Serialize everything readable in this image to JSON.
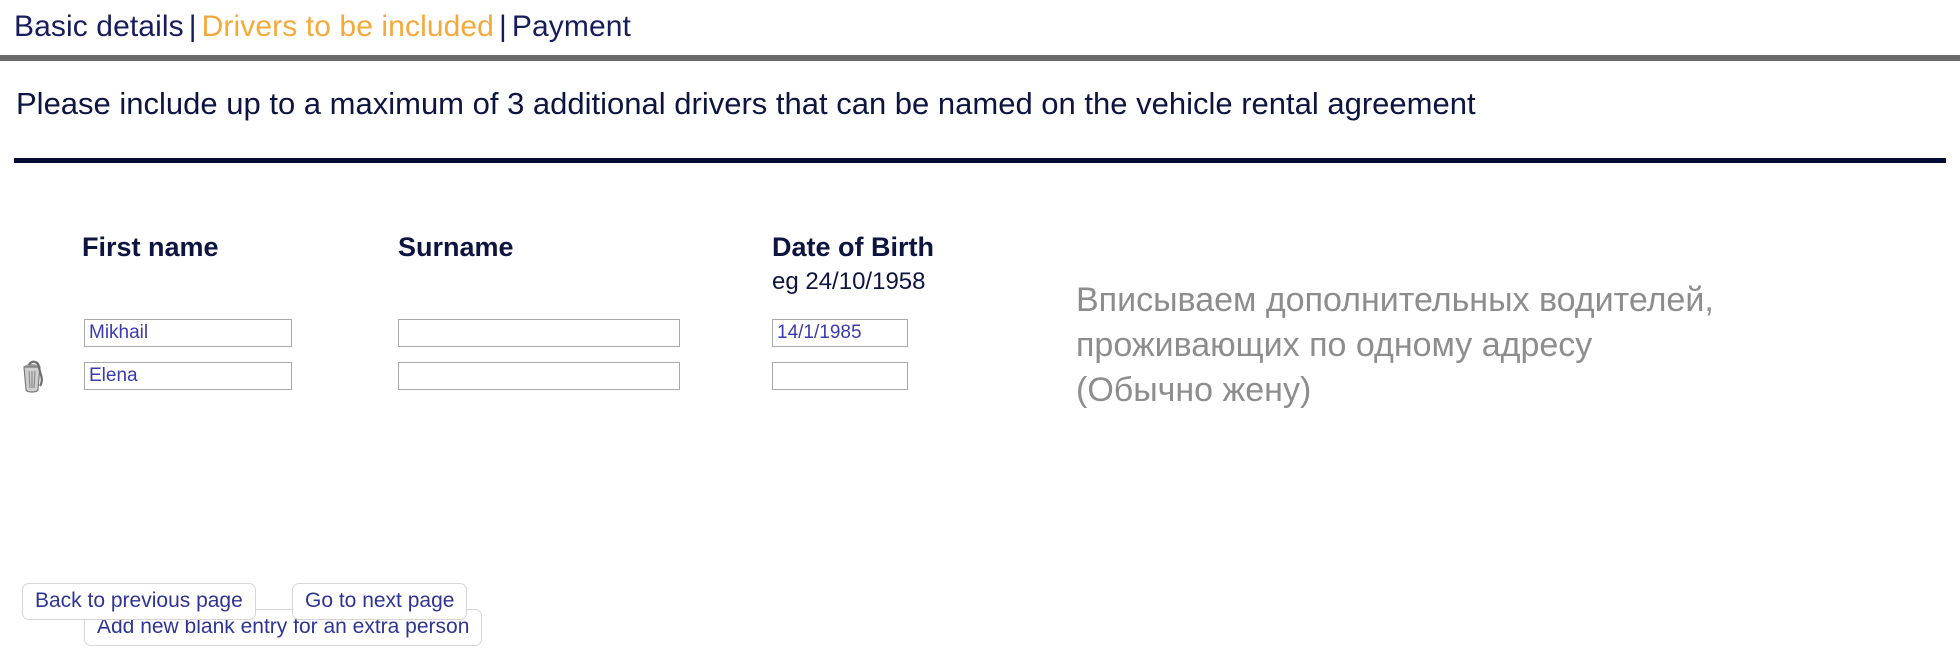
{
  "breadcrumb": {
    "basic_details": "Basic details",
    "separator": "|",
    "drivers": "Drivers to be included",
    "payment": "Payment",
    "active_color": "#f5a93b",
    "inactive_color": "#171c5c"
  },
  "instruction": "Please include up to a maximum of 3 additional drivers that can be named on the vehicle rental agreement",
  "table": {
    "headers": {
      "first_name": "First name",
      "surname": "Surname",
      "date_of_birth": "Date of Birth"
    },
    "dob_example": "eg 24/10/1958",
    "rows": [
      {
        "first_name": "Mikhail",
        "surname": "",
        "dob": "14/1/1985"
      },
      {
        "first_name": "Elena",
        "surname": "",
        "dob": ""
      }
    ]
  },
  "buttons": {
    "add_entry": "Add new blank entry for an extra person",
    "back": "Back to previous page",
    "next": "Go to next page"
  },
  "icons": {
    "delete_row": "trash-icon"
  },
  "annotation": {
    "line1": "Вписываем дополнительных водителей,",
    "line2": "проживающих по одному адресу",
    "line3": "(Обычно жену)",
    "color": "#8d8d8d"
  }
}
